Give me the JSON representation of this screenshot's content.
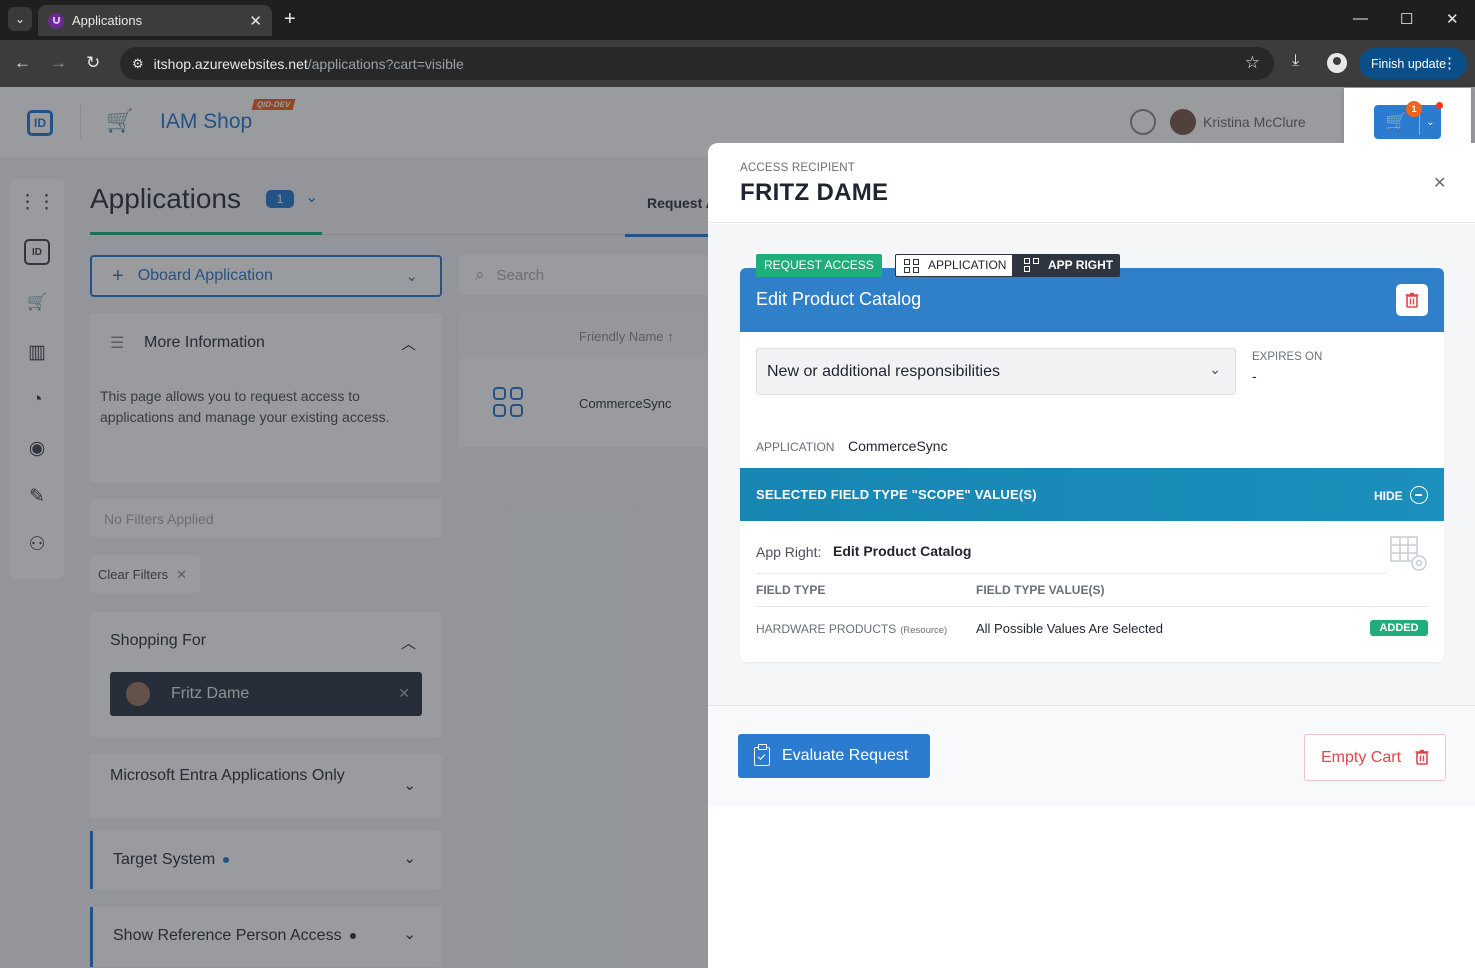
{
  "browser": {
    "tab_title": "Applications",
    "url_host": "itshop.azurewebsites.net",
    "url_path": "/applications?cart=visible",
    "finish_update_label": "Finish update"
  },
  "app": {
    "shop_title": "IAM Shop",
    "env_badge": "QID-DEV",
    "user_name": "Kristina McClure",
    "page_title": "Applications",
    "page_count": "1",
    "request_tab_label": "Request A",
    "onboard_label": "Oboard Application",
    "search_placeholder": "Search",
    "more_info": {
      "title": "More Information",
      "text": "This page allows you to request access to applications and manage your existing access."
    },
    "filters_text": "No Filters Applied",
    "clear_filters_label": "Clear Filters",
    "shopping_for": {
      "title": "Shopping For",
      "person": "Fritz Dame"
    },
    "sections": [
      {
        "title": "Microsoft Entra Applications Only"
      },
      {
        "title": "Target System"
      },
      {
        "title": "Show Reference Person Access"
      }
    ],
    "grid": {
      "column_header": "Friendly Name",
      "rows": [
        {
          "name": "CommerceSync"
        }
      ]
    }
  },
  "cart": {
    "count": "1"
  },
  "drawer": {
    "recipient_label": "ACCESS RECIPIENT",
    "recipient_name": "FRITZ DAME",
    "tags": {
      "request_access": "REQUEST ACCESS",
      "application": "APPLICATION",
      "app_right": "APP RIGHT"
    },
    "item": {
      "title": "Edit Product Catalog",
      "reason_value": "New or additional responsibilities",
      "expires_label": "EXPIRES ON",
      "expires_value": "-",
      "application_label": "APPLICATION",
      "application_value": "CommerceSync",
      "scope_title": "SELECTED FIELD TYPE \"SCOPE\" VALUE(S)",
      "hide_label": "HIDE",
      "app_right_label": "App Right:",
      "app_right_value": "Edit Product Catalog",
      "columns": [
        "FIELD TYPE",
        "FIELD TYPE VALUE(S)"
      ],
      "rows": [
        {
          "field": "HARDWARE PRODUCTS",
          "field_note": "(Resource)",
          "value": "All Possible Values Are Selected",
          "status": "ADDED"
        }
      ]
    },
    "evaluate_label": "Evaluate Request",
    "empty_cart_label": "Empty Cart"
  },
  "colors": {
    "primary": "#2b7bd0",
    "success": "#1fae7a",
    "danger": "#e0474c",
    "scope_bar": "#1786b3"
  }
}
